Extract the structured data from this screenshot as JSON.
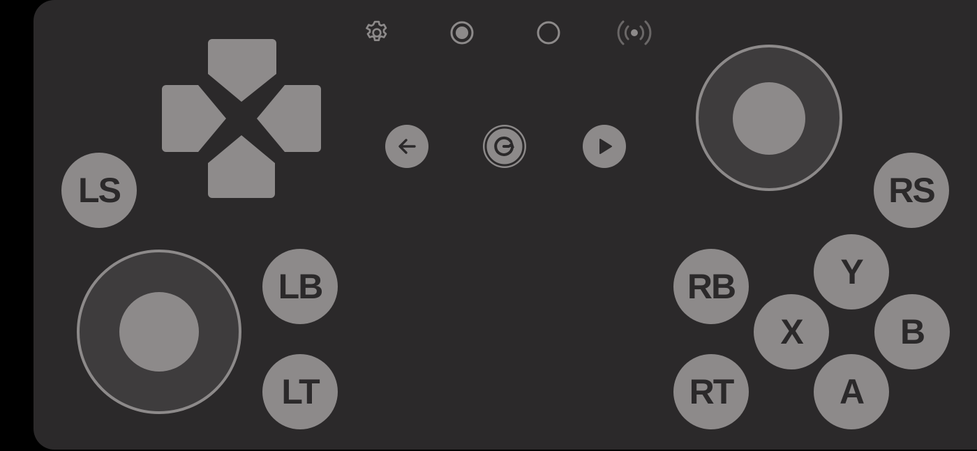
{
  "colors": {
    "background": "#000000",
    "panel": "#2b292a",
    "control": "#8d8a8a",
    "stick_base": "#3e3c3d",
    "label": "#2b292a"
  },
  "toolbar": {
    "icons": [
      "gear-icon",
      "radio-selected-icon",
      "radio-empty-icon",
      "broadcast-icon"
    ]
  },
  "center_controls": {
    "icons": [
      "back-arrow-icon",
      "refresh-icon",
      "play-icon"
    ]
  },
  "dpad": {
    "directions": [
      "up",
      "left",
      "right",
      "down"
    ]
  },
  "buttons": {
    "ls": "LS",
    "rs": "RS",
    "lb": "LB",
    "lt": "LT",
    "rb": "RB",
    "rt": "RT",
    "y": "Y",
    "x": "X",
    "b": "B",
    "a": "A"
  },
  "sticks": [
    "left-joystick",
    "right-joystick"
  ]
}
